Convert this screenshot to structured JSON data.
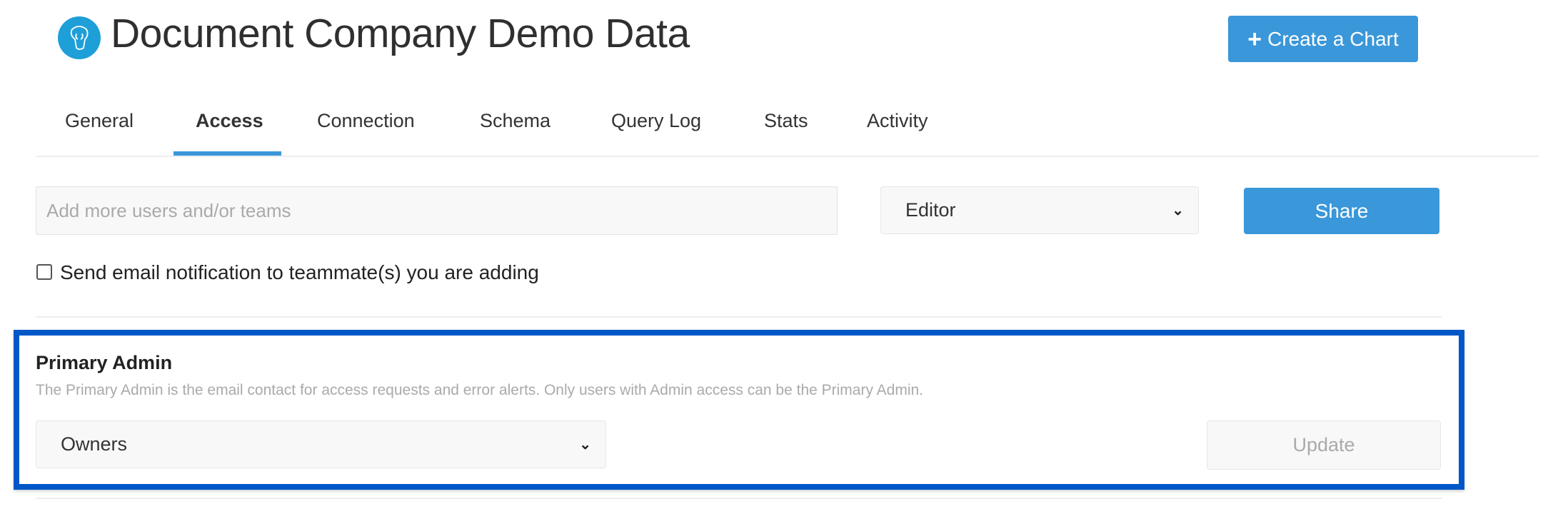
{
  "header": {
    "logo_icon": "postgresql-elephant-icon",
    "title": "Document Company Demo Data",
    "create_chart_label": "Create a Chart",
    "create_chart_icon": "plus-icon"
  },
  "tabs": [
    {
      "label": "General",
      "active": false
    },
    {
      "label": "Access",
      "active": true
    },
    {
      "label": "Connection",
      "active": false
    },
    {
      "label": "Schema",
      "active": false
    },
    {
      "label": "Query Log",
      "active": false
    },
    {
      "label": "Stats",
      "active": false
    },
    {
      "label": "Activity",
      "active": false
    }
  ],
  "share": {
    "input_placeholder": "Add more users and/or teams",
    "input_value": "",
    "role_selected": "Editor",
    "share_label": "Share",
    "notify_label": "Send email notification to teammate(s) you are adding",
    "notify_checked": false
  },
  "primary_admin": {
    "title": "Primary Admin",
    "description": "The Primary Admin is the email contact for access requests and error alerts. Only users with Admin access can be the Primary Admin.",
    "selected": "Owners",
    "update_label": "Update"
  },
  "colors": {
    "accent": "#3a97d9",
    "highlight": "#0057c8"
  }
}
